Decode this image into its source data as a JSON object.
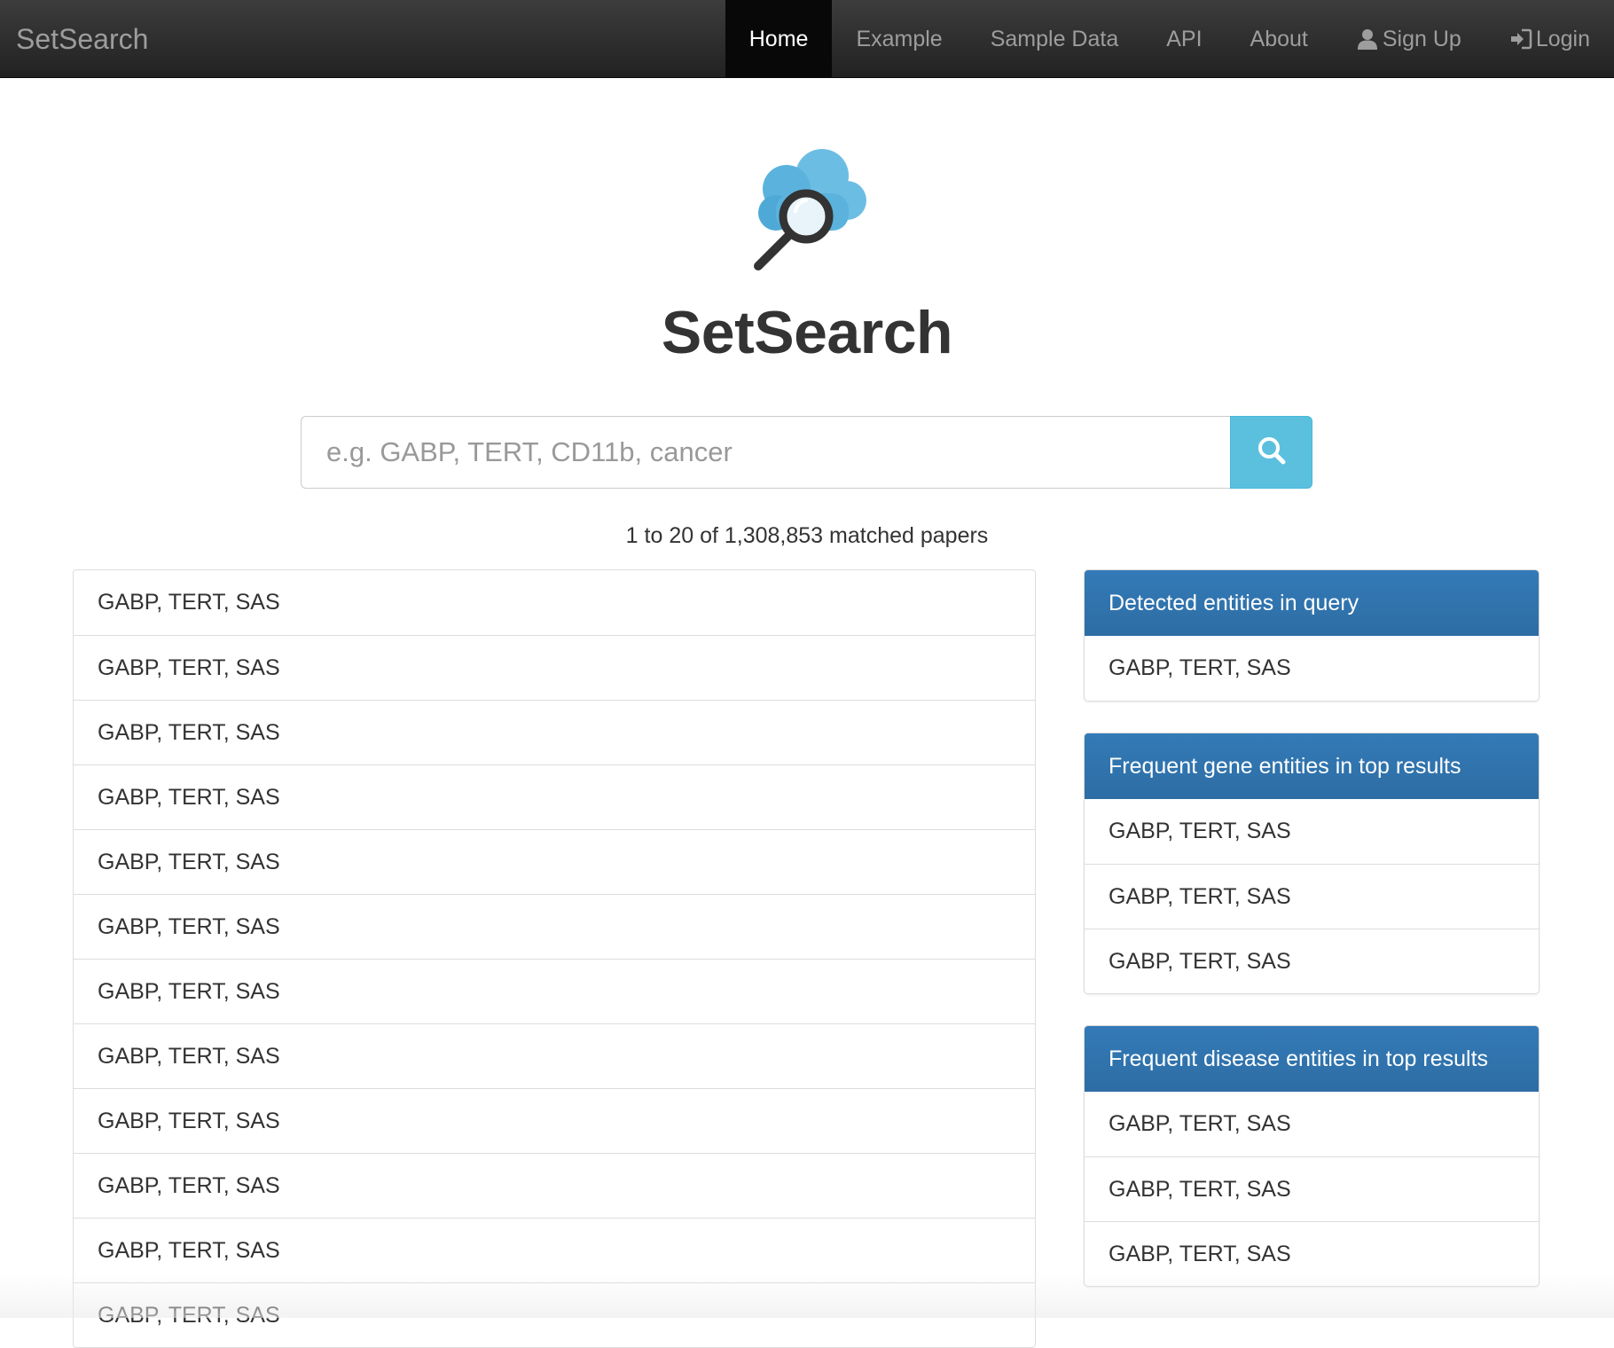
{
  "navbar": {
    "brand": "SetSearch",
    "items": [
      {
        "label": "Home",
        "active": true
      },
      {
        "label": "Example"
      },
      {
        "label": "Sample Data"
      },
      {
        "label": "API"
      },
      {
        "label": "About"
      },
      {
        "label": "Sign Up",
        "icon": "user-icon"
      },
      {
        "label": "Login",
        "icon": "login-icon"
      }
    ]
  },
  "hero": {
    "logo_icon": "cloud-search-icon",
    "title": "SetSearch"
  },
  "search": {
    "value": "",
    "placeholder": "e.g. GABP, TERT, CD11b, cancer",
    "button_icon": "search-icon"
  },
  "results": {
    "count_text": "1 to 20 of 1,308,853 matched papers",
    "items": [
      "GABP, TERT, SAS",
      "GABP, TERT, SAS",
      "GABP, TERT, SAS",
      "GABP, TERT, SAS",
      "GABP, TERT, SAS",
      "GABP, TERT, SAS",
      "GABP, TERT, SAS",
      "GABP, TERT, SAS",
      "GABP, TERT, SAS",
      "GABP, TERT, SAS",
      "GABP, TERT, SAS",
      "GABP, TERT, SAS"
    ]
  },
  "panels": [
    {
      "title": "Detected entities in query",
      "items": [
        "GABP, TERT, SAS"
      ]
    },
    {
      "title": "Frequent gene entities in top results",
      "items": [
        "GABP, TERT, SAS",
        "GABP, TERT, SAS",
        "GABP, TERT, SAS"
      ]
    },
    {
      "title": "Frequent disease entities in top results",
      "items": [
        "GABP, TERT, SAS",
        "GABP, TERT, SAS",
        "GABP, TERT, SAS"
      ]
    }
  ],
  "colors": {
    "navbar_bg": "#222222",
    "search_button": "#5bc0de",
    "panel_heading": "#337ab7",
    "logo_cloud": "#5bb3dd",
    "logo_magnifier": "#333333"
  }
}
